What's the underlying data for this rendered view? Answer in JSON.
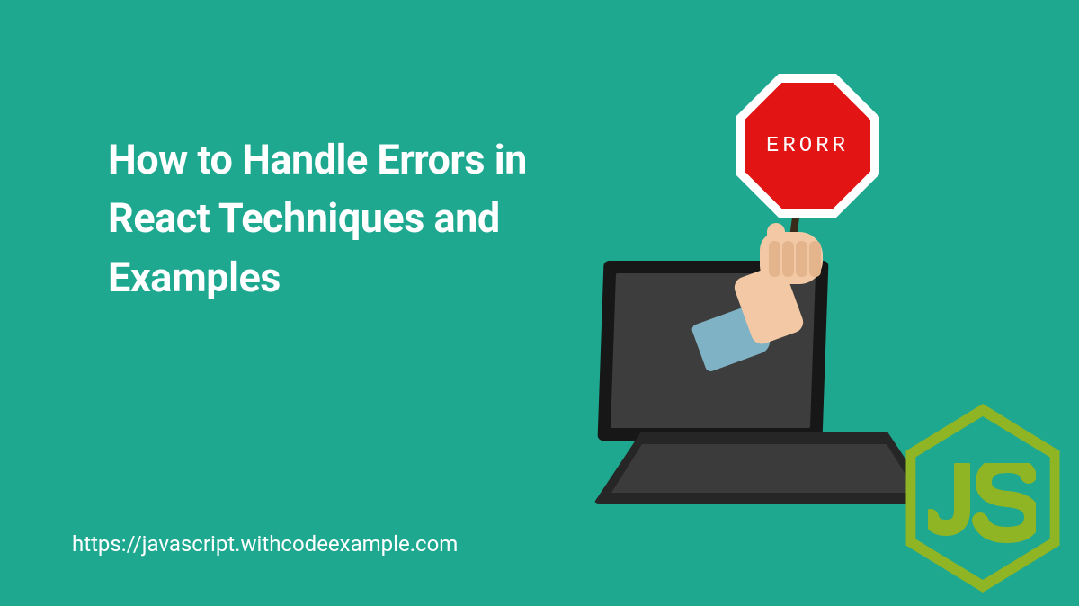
{
  "title": "How to Handle Errors in React Techniques and Examples",
  "source_url": "https://javascript.withcodeexample.com",
  "sign_label": "ERORR",
  "logo_text": "JS",
  "colors": {
    "background": "#1ea890",
    "text": "#ffffff",
    "sign_bg": "#e31414",
    "sign_border": "#ffffff",
    "logo": "#8fb424",
    "laptop": "#262626",
    "skin": "#f3c9a5",
    "cuff": "#7fb2c4"
  }
}
